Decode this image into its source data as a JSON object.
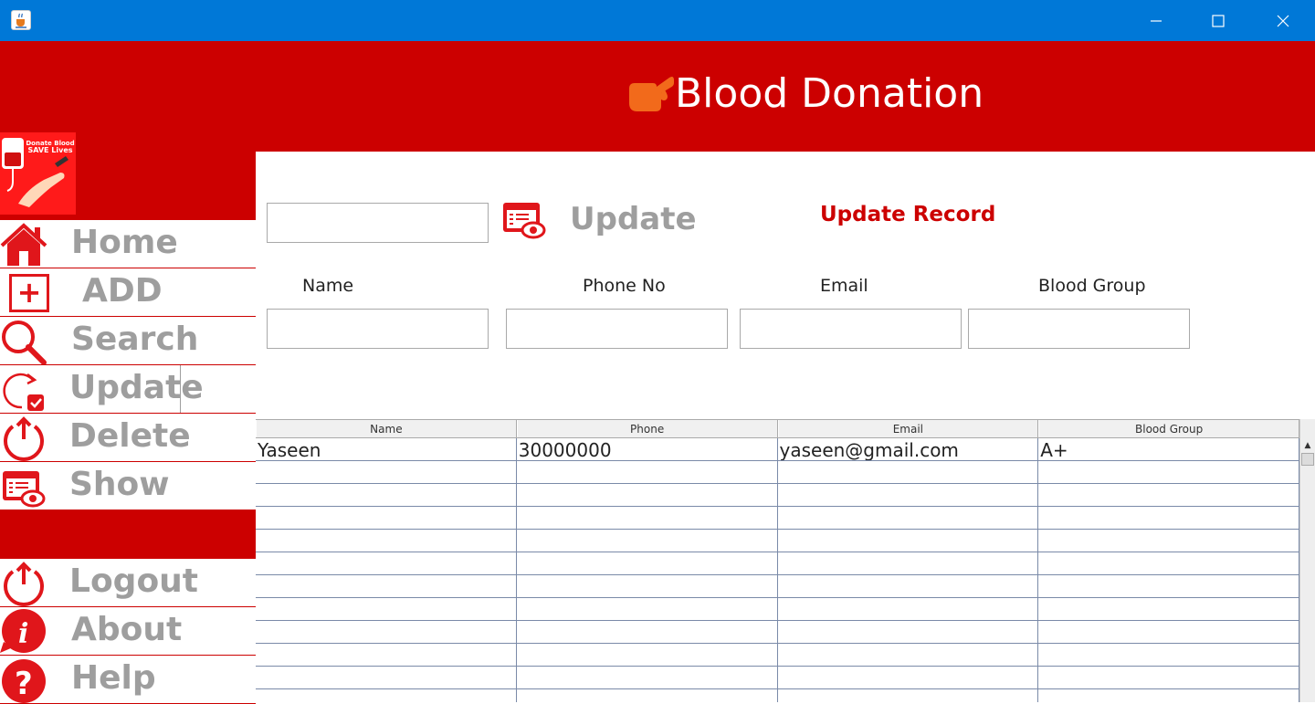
{
  "window": {
    "icon": "java-cup-icon",
    "controls": [
      "minimize-icon",
      "maximize-icon",
      "close-icon"
    ]
  },
  "header": {
    "title": "Blood Donation",
    "icon": "blood-drop-hand-icon",
    "bg_color": "#cc0000"
  },
  "logo": {
    "line1": "Donate Blood",
    "line2": "SAVE Lives"
  },
  "sidebar": {
    "items": [
      {
        "label": "Home",
        "icon": "home-icon"
      },
      {
        "label": "ADD",
        "icon": "plus-icon"
      },
      {
        "label": "Search",
        "icon": "search-icon"
      },
      {
        "label": "Update",
        "icon": "update-icon"
      },
      {
        "label": "Delete",
        "icon": "power-icon"
      },
      {
        "label": "Show",
        "icon": "show-records-icon"
      }
    ],
    "footer_items": [
      {
        "label": "Logout",
        "icon": "power-icon"
      },
      {
        "label": "About",
        "icon": "info-icon"
      },
      {
        "label": "Help",
        "icon": "help-icon"
      }
    ]
  },
  "form": {
    "search_value": "",
    "update_button_label": "Update",
    "title": "Update Record",
    "labels": {
      "name": "Name",
      "phone": "Phone No",
      "email": "Email",
      "blood_group": "Blood Group"
    },
    "values": {
      "name": "",
      "phone": "",
      "email": "",
      "blood_group": ""
    }
  },
  "table": {
    "columns": [
      "Name",
      "Phone",
      "Email",
      "Blood Group"
    ],
    "rows": [
      [
        "Yaseen",
        "30000000",
        "yaseen@gmail.com",
        "A+"
      ]
    ]
  },
  "colors": {
    "accent_red": "#cc0000",
    "icon_red": "#e0161b",
    "menu_text_gray": "#9e9e9e",
    "titlebar_blue": "#0078d7"
  }
}
